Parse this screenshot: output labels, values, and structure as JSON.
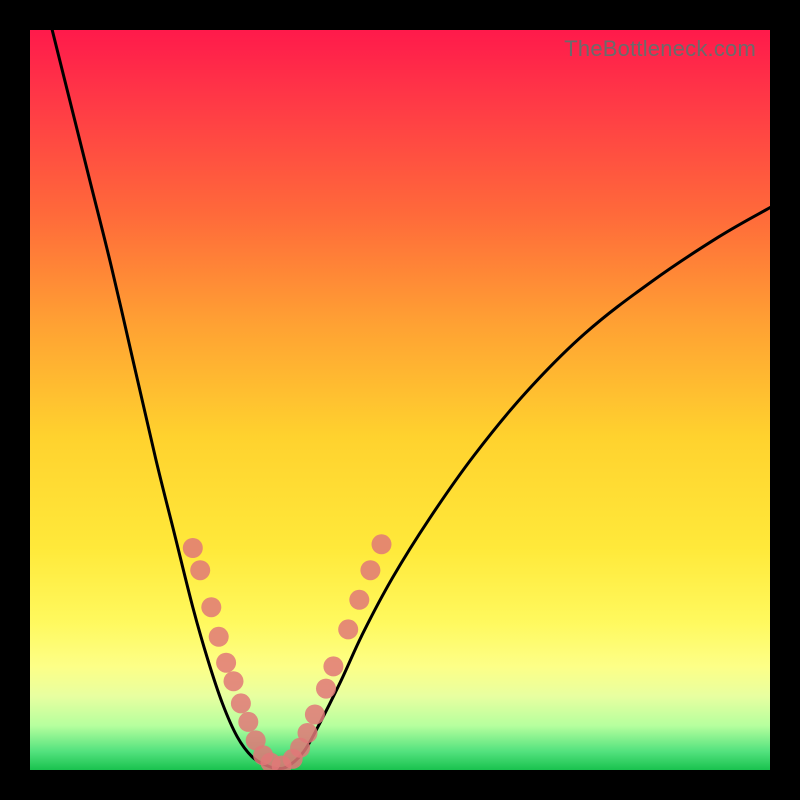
{
  "watermark": "TheBottleneck.com",
  "chart_data": {
    "type": "line",
    "title": "",
    "xlabel": "",
    "ylabel": "",
    "xlim": [
      0,
      100
    ],
    "ylim": [
      0,
      100
    ],
    "background": {
      "gradient_stops": [
        {
          "offset": 0.0,
          "color": "#ff1a4b"
        },
        {
          "offset": 0.1,
          "color": "#ff3a46"
        },
        {
          "offset": 0.25,
          "color": "#ff6a3a"
        },
        {
          "offset": 0.4,
          "color": "#ffa233"
        },
        {
          "offset": 0.55,
          "color": "#ffd22e"
        },
        {
          "offset": 0.7,
          "color": "#ffe93a"
        },
        {
          "offset": 0.8,
          "color": "#fff95e"
        },
        {
          "offset": 0.86,
          "color": "#fdff87"
        },
        {
          "offset": 0.9,
          "color": "#e8ffa0"
        },
        {
          "offset": 0.94,
          "color": "#b6ff9e"
        },
        {
          "offset": 0.975,
          "color": "#53e27e"
        },
        {
          "offset": 1.0,
          "color": "#19c24e"
        }
      ]
    },
    "series": [
      {
        "name": "bottleneck-curve",
        "stroke": "#000000",
        "stroke_width": 3,
        "points": [
          {
            "x": 3.0,
            "y": 100.0
          },
          {
            "x": 5.0,
            "y": 92.0
          },
          {
            "x": 8.0,
            "y": 80.0
          },
          {
            "x": 11.0,
            "y": 68.0
          },
          {
            "x": 14.0,
            "y": 55.0
          },
          {
            "x": 17.0,
            "y": 42.0
          },
          {
            "x": 19.5,
            "y": 32.0
          },
          {
            "x": 22.0,
            "y": 22.0
          },
          {
            "x": 24.0,
            "y": 15.0
          },
          {
            "x": 26.0,
            "y": 9.0
          },
          {
            "x": 28.0,
            "y": 4.5
          },
          {
            "x": 30.0,
            "y": 1.8
          },
          {
            "x": 32.0,
            "y": 0.6
          },
          {
            "x": 33.5,
            "y": 0.2
          },
          {
            "x": 35.0,
            "y": 0.6
          },
          {
            "x": 37.0,
            "y": 2.5
          },
          {
            "x": 39.0,
            "y": 6.0
          },
          {
            "x": 42.0,
            "y": 12.0
          },
          {
            "x": 45.0,
            "y": 18.5
          },
          {
            "x": 49.0,
            "y": 26.0
          },
          {
            "x": 54.0,
            "y": 34.0
          },
          {
            "x": 60.0,
            "y": 42.5
          },
          {
            "x": 67.0,
            "y": 51.0
          },
          {
            "x": 75.0,
            "y": 59.0
          },
          {
            "x": 84.0,
            "y": 66.0
          },
          {
            "x": 93.0,
            "y": 72.0
          },
          {
            "x": 100.0,
            "y": 76.0
          }
        ]
      }
    ],
    "markers": {
      "color": "#e07878",
      "radius": 10,
      "points": [
        {
          "x": 22.0,
          "y": 30.0
        },
        {
          "x": 23.0,
          "y": 27.0
        },
        {
          "x": 24.5,
          "y": 22.0
        },
        {
          "x": 25.5,
          "y": 18.0
        },
        {
          "x": 26.5,
          "y": 14.5
        },
        {
          "x": 27.5,
          "y": 12.0
        },
        {
          "x": 28.5,
          "y": 9.0
        },
        {
          "x": 29.5,
          "y": 6.5
        },
        {
          "x": 30.5,
          "y": 4.0
        },
        {
          "x": 31.5,
          "y": 2.0
        },
        {
          "x": 32.5,
          "y": 1.0
        },
        {
          "x": 34.0,
          "y": 0.6
        },
        {
          "x": 35.5,
          "y": 1.5
        },
        {
          "x": 36.5,
          "y": 3.0
        },
        {
          "x": 37.5,
          "y": 5.0
        },
        {
          "x": 38.5,
          "y": 7.5
        },
        {
          "x": 40.0,
          "y": 11.0
        },
        {
          "x": 41.0,
          "y": 14.0
        },
        {
          "x": 43.0,
          "y": 19.0
        },
        {
          "x": 44.5,
          "y": 23.0
        },
        {
          "x": 46.0,
          "y": 27.0
        },
        {
          "x": 47.5,
          "y": 30.5
        }
      ]
    }
  }
}
